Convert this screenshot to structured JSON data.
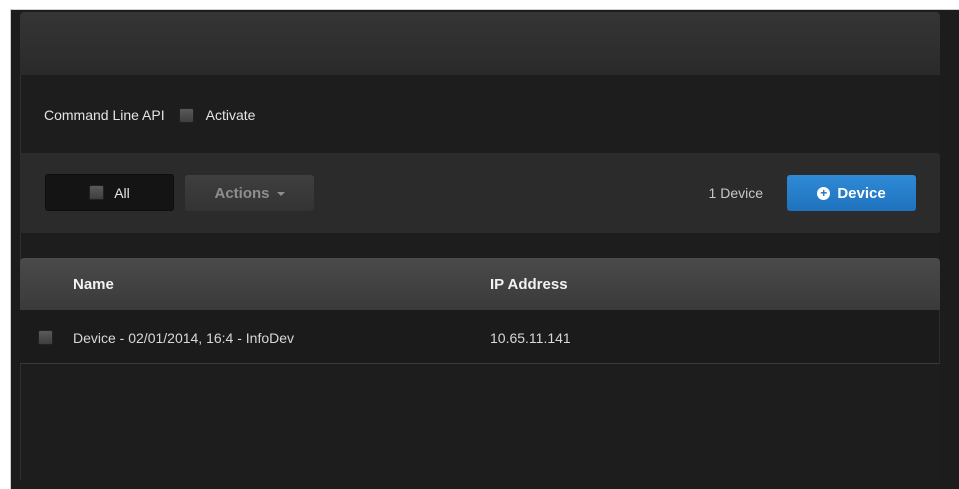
{
  "cli": {
    "label": "Command Line API",
    "activate_label": "Activate"
  },
  "toolbar": {
    "all_label": "All",
    "actions_label": "Actions",
    "device_count": "1 Device",
    "add_device_label": "Device"
  },
  "table": {
    "columns": [
      "Name",
      "IP Address"
    ],
    "rows": [
      {
        "name": "Device - 02/01/2014, 16:4 - InfoDev",
        "ip": "10.65.11.141"
      }
    ]
  },
  "colors": {
    "accent": "#2f8ad6",
    "background": "#1c1c1c"
  },
  "icons": {
    "add_device": "plus-circle-icon",
    "actions_dropdown": "caret-down-icon"
  }
}
